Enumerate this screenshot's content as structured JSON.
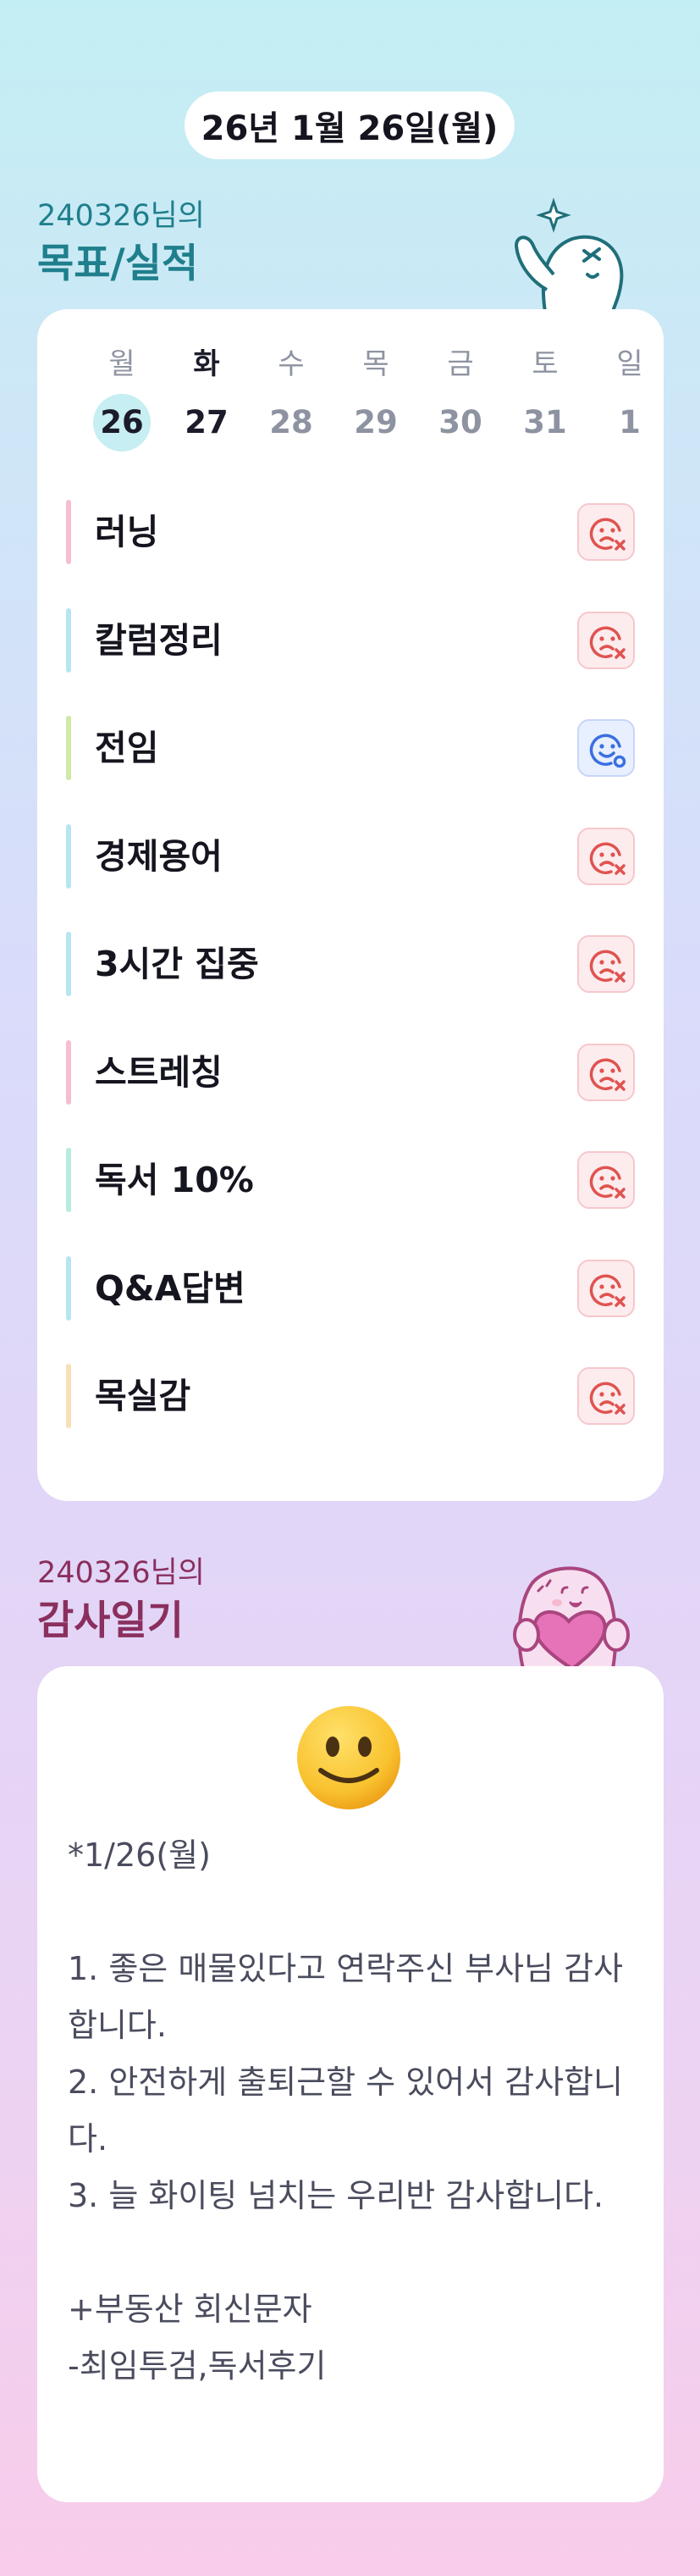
{
  "header": {
    "date": "26년 1월 26일(월)"
  },
  "goals_section": {
    "subtitle": "240326님의",
    "title": "목표/실적",
    "week": [
      {
        "weekday": "월",
        "day": "26",
        "selected": true,
        "today": false
      },
      {
        "weekday": "화",
        "day": "27",
        "selected": false,
        "today": true
      },
      {
        "weekday": "수",
        "day": "28",
        "selected": false,
        "today": false
      },
      {
        "weekday": "목",
        "day": "29",
        "selected": false,
        "today": false
      },
      {
        "weekday": "금",
        "day": "30",
        "selected": false,
        "today": false
      },
      {
        "weekday": "토",
        "day": "31",
        "selected": false,
        "today": false
      },
      {
        "weekday": "일",
        "day": "1",
        "selected": false,
        "today": false
      }
    ],
    "goals": [
      {
        "label": "러닝",
        "color": "#f6bdd3",
        "status": "fail",
        "icon": "sad-face-x-icon"
      },
      {
        "label": "칼럼정리",
        "color": "#b5e6f1",
        "status": "fail",
        "icon": "sad-face-x-icon"
      },
      {
        "label": "전임",
        "color": "#cfe9a6",
        "status": "done",
        "icon": "smile-face-check-icon"
      },
      {
        "label": "경제용어",
        "color": "#b5e6f1",
        "status": "fail",
        "icon": "sad-face-x-icon"
      },
      {
        "label": "3시간 집중",
        "color": "#b5e6f1",
        "status": "fail",
        "icon": "sad-face-x-icon"
      },
      {
        "label": "스트레칭",
        "color": "#f6bdd3",
        "status": "fail",
        "icon": "sad-face-x-icon"
      },
      {
        "label": "독서 10%",
        "color": "#b5ecdf",
        "status": "fail",
        "icon": "sad-face-x-icon"
      },
      {
        "label": "Q&A답변",
        "color": "#b5e6f1",
        "status": "fail",
        "icon": "sad-face-x-icon"
      },
      {
        "label": "목실감",
        "color": "#f9dfb4",
        "status": "fail",
        "icon": "sad-face-x-icon"
      }
    ]
  },
  "gratitude_section": {
    "subtitle": "240326님의",
    "title": "감사일기",
    "mood_icon": "slightly-smiling-face-icon",
    "body": "*1/26(월)\n\n1. 좋은 매물있다고 연락주신 부사님 감사합니다.\n2. 안전하게 출퇴근할 수 있어서 감사합니다.\n3. 늘 화이팅 넘치는 우리반 감사합니다.\n\n+부동산 회신문자\n-최임투검,독서후기"
  },
  "colors": {
    "goals_accent": "#1f7f8c",
    "gratitude_accent": "#8a2f5e",
    "fail": "#e0534f",
    "done": "#3a6fe0",
    "selected_day": "#c7eef2"
  }
}
